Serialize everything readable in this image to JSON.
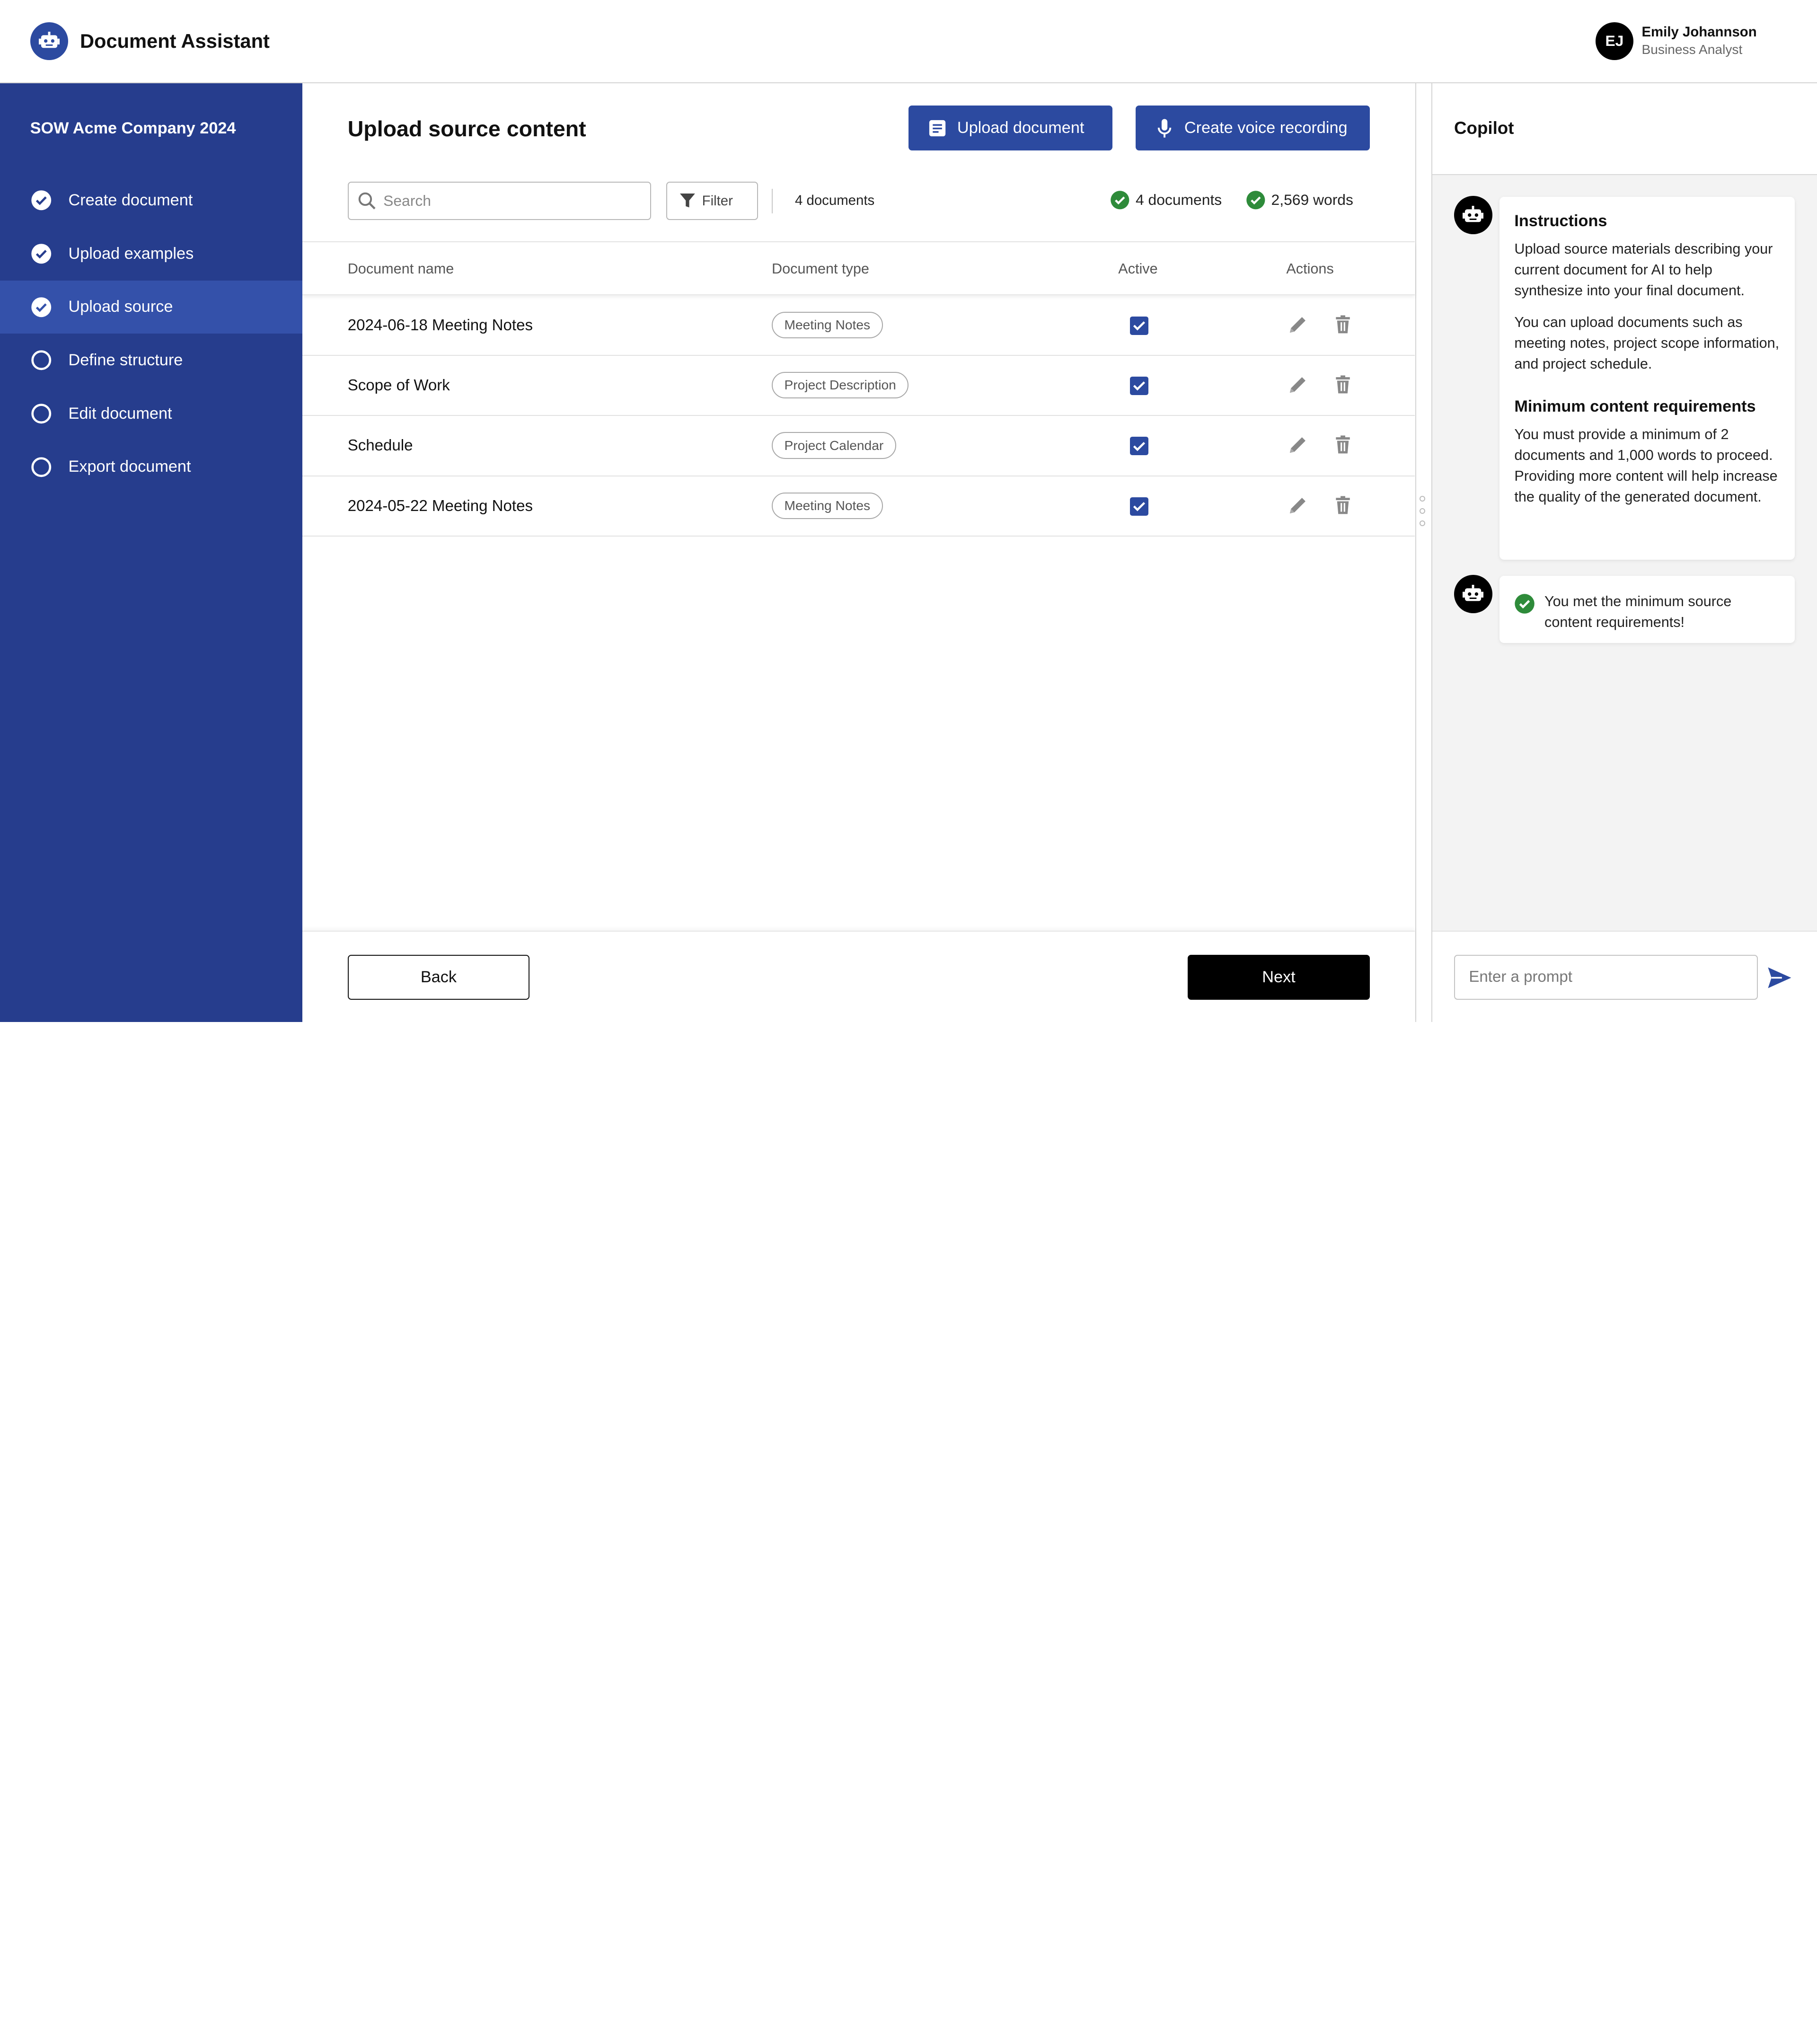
{
  "header": {
    "app_title": "Document Assistant",
    "logo_icon": "robot-icon",
    "user": {
      "initials": "EJ",
      "name": "Emily Johannson",
      "role": "Business Analyst"
    }
  },
  "sidebar": {
    "project_title": "SOW Acme Company 2024",
    "steps": [
      {
        "label": "Create document",
        "status": "complete"
      },
      {
        "label": "Upload examples",
        "status": "complete"
      },
      {
        "label": "Upload source",
        "status": "current"
      },
      {
        "label": "Define structure",
        "status": "pending"
      },
      {
        "label": "Edit document",
        "status": "pending"
      },
      {
        "label": "Export document",
        "status": "pending"
      }
    ]
  },
  "main": {
    "title": "Upload source content",
    "upload_button": "Upload document",
    "voice_button": "Create voice recording",
    "search_placeholder": "Search",
    "filter_label": "Filter",
    "doc_count": "4 documents",
    "stats": {
      "documents": "4 documents",
      "words": "2,569 words"
    },
    "columns": [
      "Document name",
      "Document type",
      "Active",
      "Actions"
    ],
    "rows": [
      {
        "name": "2024-06-18 Meeting Notes",
        "type": "Meeting Notes",
        "active": true
      },
      {
        "name": "Scope of Work",
        "type": "Project Description",
        "active": true
      },
      {
        "name": "Schedule",
        "type": "Project Calendar",
        "active": true
      },
      {
        "name": "2024-05-22 Meeting Notes",
        "type": "Meeting Notes",
        "active": true
      }
    ],
    "back_label": "Back",
    "next_label": "Next"
  },
  "copilot": {
    "title": "Copilot",
    "instructions": {
      "heading": "Instructions",
      "p1": "Upload source materials describing your current document for AI to help synthesize into your final document.",
      "p2": "You can upload documents such as meeting notes, project scope information, and project schedule.",
      "heading2": "Minimum content requirements",
      "p3": "You must provide a minimum of 2 documents and 1,000 words to proceed. Providing more content will help increase the quality of the generated document."
    },
    "success_message": "You met the minimum source content requirements!",
    "prompt_placeholder": "Enter a prompt"
  },
  "colors": {
    "primary": "#2c4aa0",
    "sidebar": "#263d8d",
    "sidebar_active": "#3451aa",
    "success": "#2e8b3a"
  }
}
